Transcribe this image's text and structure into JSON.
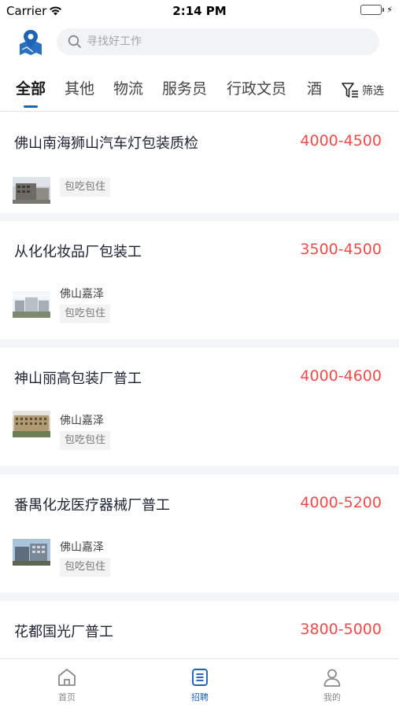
{
  "status_bar": {
    "carrier": "Carrier",
    "time": "2:14 PM",
    "battery_level": 1.0
  },
  "header": {
    "location_icon": "map-location-icon",
    "search_placeholder": "寻找好工作"
  },
  "tabs": {
    "items": [
      {
        "label": "全部",
        "active": true
      },
      {
        "label": "其他",
        "active": false
      },
      {
        "label": "物流",
        "active": false
      },
      {
        "label": "服务员",
        "active": false
      },
      {
        "label": "行政文员",
        "active": false
      },
      {
        "label": "酒",
        "active": false
      }
    ],
    "filter_label": "筛选"
  },
  "jobs": [
    {
      "title": "佛山南海狮山汽车灯包装质检",
      "salary": "4000-4500",
      "company": "",
      "tag": "包吃包住"
    },
    {
      "title": "从化化妆品厂包装工",
      "salary": "3500-4500",
      "company": "佛山嘉泽",
      "tag": "包吃包住"
    },
    {
      "title": "神山丽高包装厂普工",
      "salary": "4000-4600",
      "company": "佛山嘉泽",
      "tag": "包吃包住"
    },
    {
      "title": "番禺化龙医疗器械厂普工",
      "salary": "4000-5200",
      "company": "佛山嘉泽",
      "tag": "包吃包住"
    },
    {
      "title": "花都国光厂普工",
      "salary": "3800-5000",
      "company": "",
      "tag": ""
    }
  ],
  "bottom_nav": {
    "items": [
      {
        "label": "首页",
        "icon": "home-icon",
        "active": false
      },
      {
        "label": "招聘",
        "icon": "list-doc-icon",
        "active": true
      },
      {
        "label": "我的",
        "icon": "person-icon",
        "active": false
      }
    ]
  },
  "colors": {
    "accent": "#1f63b5",
    "salary": "#ef4b4b",
    "battery": "#4cd964"
  }
}
